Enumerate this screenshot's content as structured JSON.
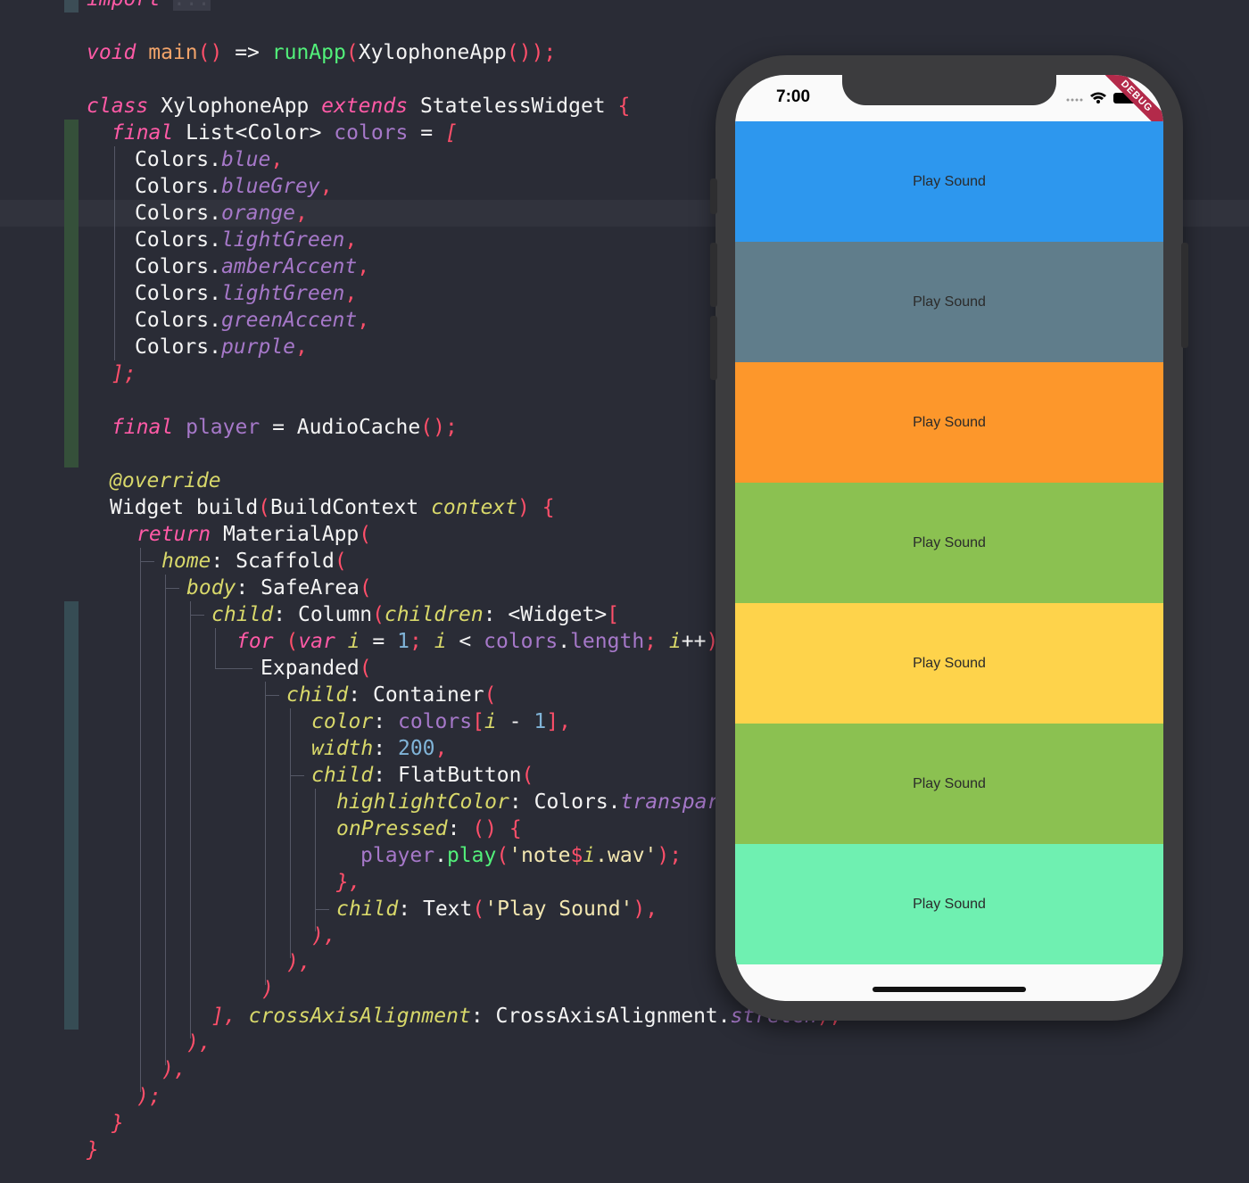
{
  "editor": {
    "lines": {
      "import_kw": "import",
      "import_fold": "...",
      "main": [
        "void",
        "main",
        "()",
        "=>",
        "runApp",
        "(",
        "XylophoneApp",
        "());"
      ],
      "class_decl": [
        "class",
        "XylophoneApp",
        "extends",
        "StatelessWidget",
        "{"
      ],
      "colors_decl": [
        "final",
        "List<Color>",
        "colors",
        "=",
        "["
      ],
      "color_items": [
        [
          "Colors.",
          "blue",
          ","
        ],
        [
          "Colors.",
          "blueGrey",
          ","
        ],
        [
          "Colors.",
          "orange",
          ","
        ],
        [
          "Colors.",
          "lightGreen",
          ","
        ],
        [
          "Colors.",
          "amberAccent",
          ","
        ],
        [
          "Colors.",
          "lightGreen",
          ","
        ],
        [
          "Colors.",
          "greenAccent",
          ","
        ],
        [
          "Colors.",
          "purple",
          ","
        ]
      ],
      "colors_close": "];",
      "player_decl": [
        "final",
        "player",
        "=",
        "AudioCache",
        "();"
      ],
      "override": "@override",
      "build": [
        "Widget build",
        "(",
        "BuildContext",
        "context",
        ")",
        "{"
      ],
      "return": [
        "return",
        "MaterialApp",
        "("
      ],
      "home": [
        "home",
        ":",
        "Scaffold",
        "("
      ],
      "body": [
        "body",
        ":",
        "SafeArea",
        "("
      ],
      "child_column": [
        "child",
        ":",
        "Column",
        "(",
        "children",
        ":",
        "<Widget>",
        "["
      ],
      "for_loop": [
        "for",
        "(",
        "var",
        "i",
        "=",
        "1",
        ";",
        "i",
        "<",
        "colors",
        ".",
        "length",
        ";",
        "i",
        "++",
        ")"
      ],
      "expanded": [
        "Expanded",
        "("
      ],
      "child_container": [
        "child",
        ":",
        "Container",
        "("
      ],
      "color_prop": [
        "color",
        ":",
        "colors",
        "[",
        "i",
        "-",
        "1",
        "],"
      ],
      "width_prop": [
        "width",
        ":",
        "200",
        ","
      ],
      "child_flat": [
        "child",
        ":",
        "FlatButton",
        "("
      ],
      "highlight": [
        "highlightColor",
        ":",
        "Colors.",
        "transparent",
        ","
      ],
      "on_pressed": [
        "onPressed",
        ":",
        "()",
        "{"
      ],
      "player_play": [
        "player",
        ".",
        "play",
        "(",
        "'note",
        "$",
        "i",
        ".wav'",
        ");"
      ],
      "close_brace": "},",
      "child_text": [
        "child",
        ":",
        "Text",
        "(",
        "'Play Sound'",
        "),"
      ],
      "close1": "),",
      "close2": "),",
      "close3": ")",
      "cross_axis": [
        "],",
        "crossAxisAlignment",
        ":",
        "CrossAxisAlignment.",
        "stretch",
        "),"
      ],
      "close4": "),",
      "close5": "),",
      "close6": ");",
      "close7": "}",
      "close8": "}"
    }
  },
  "phone": {
    "time": "7:00",
    "debug_banner": "DEBUG",
    "keys": [
      {
        "label": "Play Sound",
        "color": "#2d97ee"
      },
      {
        "label": "Play Sound",
        "color": "#607d8b"
      },
      {
        "label": "Play Sound",
        "color": "#fd972b"
      },
      {
        "label": "Play Sound",
        "color": "#8bc151"
      },
      {
        "label": "Play Sound",
        "color": "#fed34b"
      },
      {
        "label": "Play Sound",
        "color": "#8bc151"
      },
      {
        "label": "Play Sound",
        "color": "#6ff0b1"
      }
    ]
  }
}
